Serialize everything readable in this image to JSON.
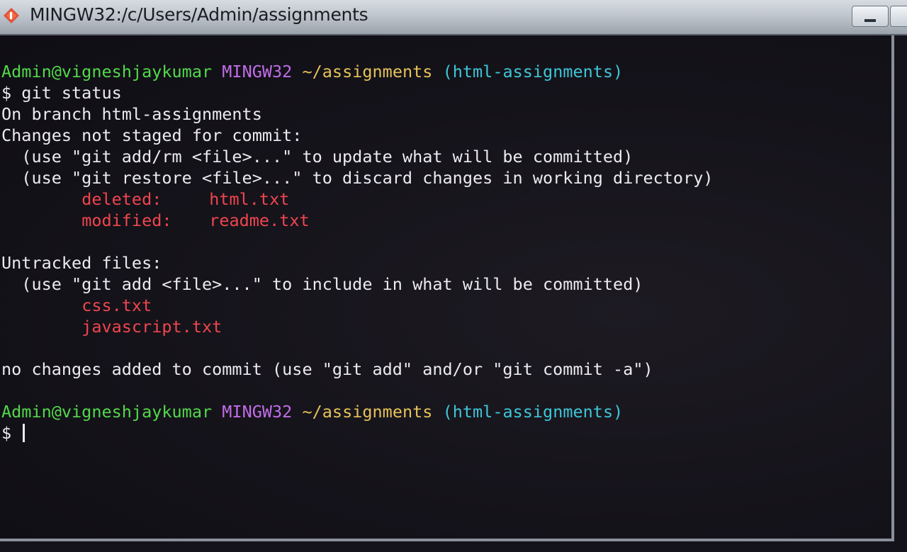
{
  "window": {
    "title": "MINGW32:/c/Users/Admin/assignments",
    "icon": "git-bash-icon",
    "minimize_icon": "minimize-icon",
    "maximize_icon": "maximize-icon"
  },
  "colors": {
    "user_host": "#52d94a",
    "shell": "#c16de8",
    "path": "#e6c25a",
    "branch": "#3ec6d8",
    "file_status": "#f0454e",
    "text": "#e6e6ea",
    "background": "#14121a"
  },
  "terminal": {
    "prompt1": {
      "user_host": "Admin@vigneshjaykumar",
      "shell": "MINGW32",
      "path": "~/assignments",
      "branch": "(html-assignments)"
    },
    "command": "$ git status",
    "line_branch": "On branch html-assignments",
    "line_changes_header": "Changes not staged for commit:",
    "hint_add_rm": "  (use \"git add/rm <file>...\" to update what will be committed)",
    "hint_restore": "  (use \"git restore <file>...\" to discard changes in working directory)",
    "changed_files": [
      {
        "status": "deleted:",
        "file": "html.txt"
      },
      {
        "status": "modified:",
        "file": "readme.txt"
      }
    ],
    "untracked_header": "Untracked files:",
    "hint_untracked": "  (use \"git add <file>...\" to include in what will be committed)",
    "untracked_files": [
      "css.txt",
      "javascript.txt"
    ],
    "summary": "no changes added to commit (use \"git add\" and/or \"git commit -a\")",
    "prompt2": {
      "user_host": "Admin@vigneshjaykumar",
      "shell": "MINGW32",
      "path": "~/assignments",
      "branch": "(html-assignments)"
    },
    "input_prompt": "$ "
  }
}
